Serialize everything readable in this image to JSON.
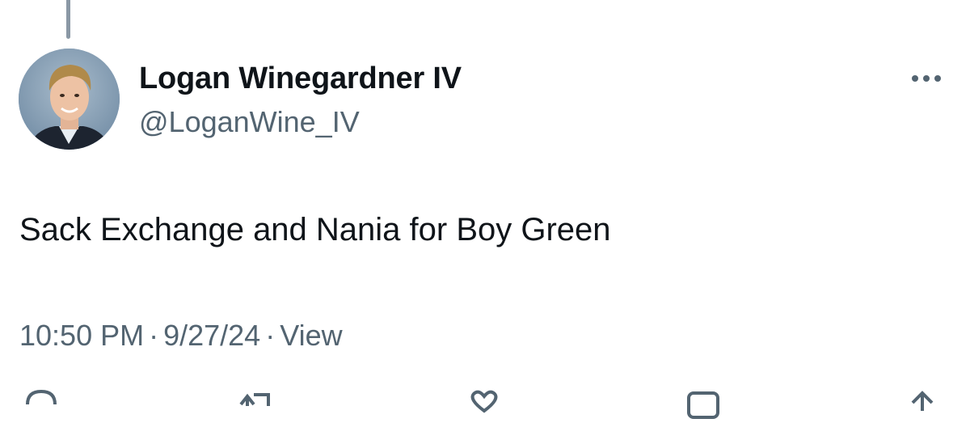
{
  "tweet": {
    "author": {
      "name": "Logan Winegardner IV",
      "handle": "@LoganWine_IV"
    },
    "text": "Sack Exchange and Nania for Boy Green",
    "meta": {
      "time": "10:50 PM",
      "separator": "·",
      "date": "9/27/24",
      "views": "View"
    }
  },
  "icons": {
    "more": "more-options-icon",
    "reply": "reply-icon",
    "retweet": "retweet-icon",
    "like": "heart-icon",
    "bookmark": "bookmark-icon",
    "share": "share-icon"
  },
  "colors": {
    "primary_text": "#0f1419",
    "secondary_text": "#536471",
    "thread_line": "#8a98a5"
  }
}
